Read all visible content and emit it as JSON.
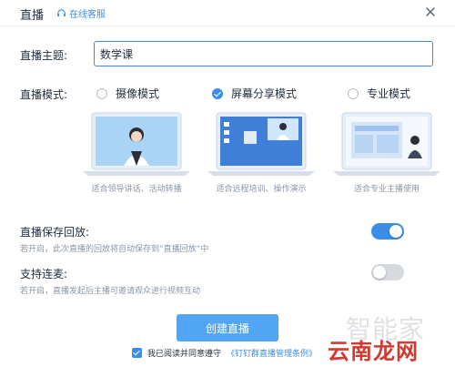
{
  "window": {
    "title": "直播",
    "service_label": "在线客服"
  },
  "topic": {
    "label": "直播主题:",
    "value": "数学课"
  },
  "mode": {
    "label": "直播模式:",
    "options": [
      {
        "label": "摄像模式",
        "selected": false,
        "caption": "适合领导讲话、活动转播"
      },
      {
        "label": "屏幕分享模式",
        "selected": true,
        "caption": "适合远程培训、操作演示"
      },
      {
        "label": "专业模式",
        "selected": false,
        "caption": "适合专业主播使用"
      }
    ]
  },
  "save_replay": {
    "label": "直播保存回放:",
    "description": "若开启，此次直播的回放将自动保存到“直播回放”中",
    "enabled": true
  },
  "co_host": {
    "label": "支持连麦:",
    "description": "若开启，直播发起后主播可邀请观众进行视频互动",
    "enabled": false
  },
  "create_button": "创建直播",
  "agreement": {
    "checked": true,
    "text": "我已阅读并同意遵守",
    "link": "《钉钉群直播管理条例》"
  },
  "watermarks": {
    "line1": "智能家",
    "line2": "云南龙网"
  },
  "colors": {
    "accent": "#3a8ee6",
    "button": "#52a5f2",
    "toggle_off": "#d6d9de"
  }
}
